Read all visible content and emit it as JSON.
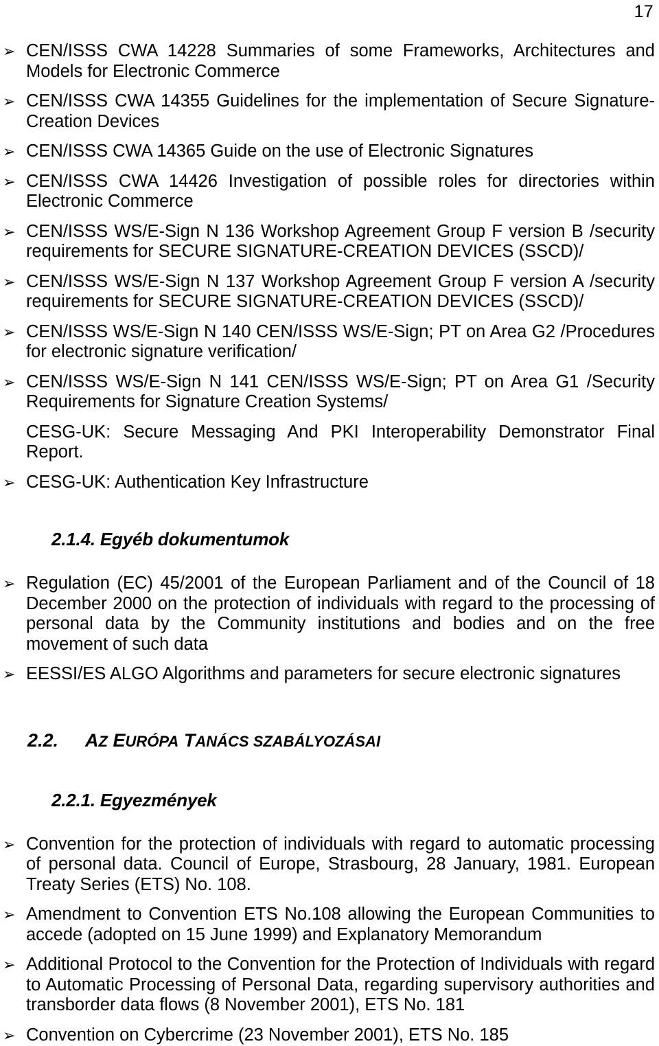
{
  "page": {
    "number": "17",
    "bullet_glyph": "➢"
  },
  "section_1": {
    "items": [
      {
        "bulleted": true,
        "text": "CEN/ISSS CWA 14228 Summaries of some Frameworks, Architectures and Models for Electronic Commerce"
      },
      {
        "bulleted": true,
        "text": "CEN/ISSS CWA 14355 Guidelines for the implementation of Secure Signature-Creation Devices"
      },
      {
        "bulleted": true,
        "text": "CEN/ISSS CWA 14365 Guide on the use of Electronic Signatures"
      },
      {
        "bulleted": true,
        "text": "CEN/ISSS CWA 14426 Investigation of possible roles for directories within Electronic Commerce"
      },
      {
        "bulleted": true,
        "text": "CEN/ISSS WS/E-Sign N 136 Workshop Agreement Group F version B /security requirements for SECURE SIGNATURE-CREATION DEVICES (SSCD)/"
      },
      {
        "bulleted": true,
        "text": "CEN/ISSS WS/E-Sign N 137 Workshop Agreement Group F version A /security requirements for SECURE SIGNATURE-CREATION DEVICES (SSCD)/"
      },
      {
        "bulleted": true,
        "text": "CEN/ISSS WS/E-Sign N 140 CEN/ISSS WS/E-Sign; PT on Area G2 /Procedures for electronic signature verification/"
      },
      {
        "bulleted": true,
        "text": "CEN/ISSS WS/E-Sign N 141 CEN/ISSS WS/E-Sign; PT on Area G1 /Security Requirements for Signature Creation Systems/"
      },
      {
        "bulleted": false,
        "text": "CESG-UK: Secure Messaging And PKI Interoperability Demonstrator Final Report."
      },
      {
        "bulleted": true,
        "text": "CESG-UK: Authentication Key Infrastructure"
      }
    ]
  },
  "section_2_1_4": {
    "heading": "2.1.4. Egyéb dokumentumok",
    "items": [
      {
        "bulleted": true,
        "text": "Regulation (EC) 45/2001 of the European Parliament and of the Council of 18 December 2000 on the protection of individuals with regard to the processing of personal data by the Community institutions and bodies and on the free movement of such data"
      },
      {
        "bulleted": true,
        "text": "EESSI/ES ALGO Algorithms and parameters for secure electronic signatures"
      }
    ]
  },
  "section_2_2": {
    "heading_number": "2.2.",
    "heading_title": "Az Európa Tanács szabályozásai",
    "heading_parts": [
      {
        "big": "A",
        "small": "Z"
      },
      {
        "big": "E",
        "small": "URÓPA"
      },
      {
        "big": "T",
        "small": "ANÁCS"
      },
      {
        "big": "",
        "small": "SZABÁLYOZÁSAI"
      }
    ]
  },
  "section_2_2_1": {
    "heading": "2.2.1. Egyezmények",
    "items": [
      {
        "bulleted": true,
        "text": "Convention for the protection of individuals with regard to automatic processing of personal data. Council of Europe, Strasbourg, 28 January, 1981. European Treaty Series (ETS) No. 108."
      },
      {
        "bulleted": true,
        "text": "Amendment to Convention ETS No.108 allowing the European Communities to accede (adopted on 15 June 1999) and Explanatory Memorandum"
      },
      {
        "bulleted": true,
        "text": "Additional Protocol to the Convention for the Protection of Individuals with regard to Automatic Processing of Personal Data, regarding supervisory authorities and transborder data flows (8 November 2001), ETS No. 181"
      },
      {
        "bulleted": true,
        "text": "Convention on Cybercrime (23 November 2001), ETS No. 185"
      }
    ]
  }
}
